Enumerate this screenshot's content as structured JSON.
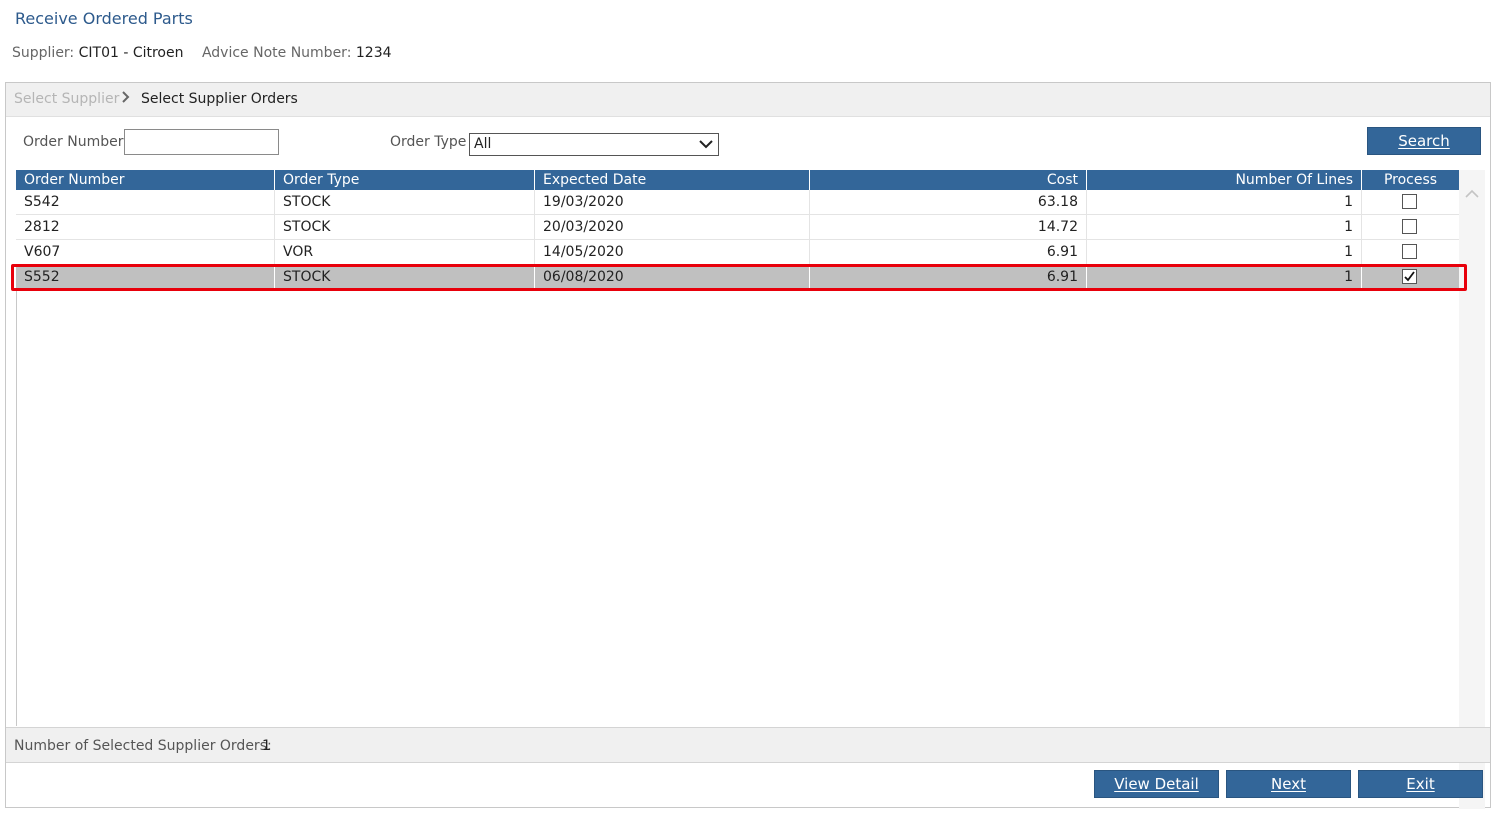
{
  "page": {
    "title": "Receive Ordered Parts"
  },
  "info": {
    "supplier_label": "Supplier:",
    "supplier_value": "CIT01 - Citroen",
    "advice_label": "Advice Note Number:",
    "advice_value": "1234"
  },
  "breadcrumb": {
    "step1": "Select Supplier",
    "separator": ">",
    "step2": "Select Supplier Orders"
  },
  "filters": {
    "order_number_label": "Order Number",
    "order_number_value": "",
    "order_type_label": "Order Type",
    "order_type_value": "All",
    "search_label": "Search"
  },
  "grid": {
    "columns": [
      "Order Number",
      "Order Type",
      "Expected Date",
      "Cost",
      "Number Of Lines",
      "Process"
    ],
    "rows": [
      {
        "order_number": "S542",
        "order_type": "STOCK",
        "expected_date": "19/03/2020",
        "cost": "63.18",
        "lines": "1",
        "process": false,
        "selected": false
      },
      {
        "order_number": "2812",
        "order_type": "STOCK",
        "expected_date": "20/03/2020",
        "cost": "14.72",
        "lines": "1",
        "process": false,
        "selected": false
      },
      {
        "order_number": "V607",
        "order_type": "VOR",
        "expected_date": "14/05/2020",
        "cost": "6.91",
        "lines": "1",
        "process": false,
        "selected": false
      },
      {
        "order_number": "S552",
        "order_type": "STOCK",
        "expected_date": "06/08/2020",
        "cost": "6.91",
        "lines": "1",
        "process": true,
        "selected": true
      }
    ]
  },
  "status": {
    "label": "Number of Selected Supplier Orders:",
    "value": "1"
  },
  "actions": {
    "view_detail": "View Detail",
    "next": "Next",
    "exit": "Exit"
  },
  "colors": {
    "accent": "#336699",
    "title": "#2d5a8c",
    "highlight_outline": "#e8000b",
    "selected_row": "#c0c0c0"
  },
  "icons": {
    "breadcrumb_separator": "chevron-right-icon",
    "dropdown": "chevron-down-icon",
    "scroll_up": "scroll-up-icon",
    "scroll_down": "scroll-down-icon",
    "checkbox_checked": "check-icon"
  }
}
